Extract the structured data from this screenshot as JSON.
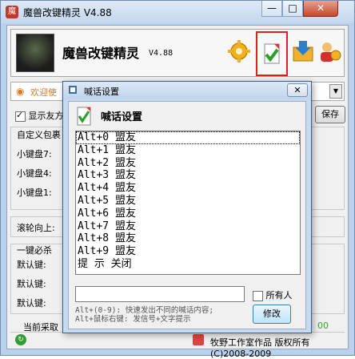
{
  "window": {
    "title": "魔兽改键精灵 V4.88",
    "min": "—",
    "max": "□",
    "close": "✕"
  },
  "header": {
    "app_title": "魔兽改键精灵",
    "version": "V4.88",
    "tools": [
      "gear-icon",
      "checkmark-document-icon",
      "download-folder-icon",
      "user-settings-icon"
    ]
  },
  "welcome": {
    "text": "欢迎使"
  },
  "show_friends": {
    "label": "显示友方",
    "checked": true
  },
  "save_button": "保存",
  "custom_group": {
    "title": "自定义包裹"
  },
  "keypads": [
    "小键盘7:",
    "小键盘4:",
    "小键盘1:"
  ],
  "scroll": {
    "label": "滚轮向上:"
  },
  "one_key_group": {
    "title": "一键必杀"
  },
  "default_keys": [
    "默认键:",
    "默认键:",
    "默认键:"
  ],
  "current_collect": "当前采取",
  "bottom_right": "00",
  "status": {
    "text": "牧野工作室作品 版权所有 (C)2008-2009"
  },
  "dialog": {
    "title": "喊话设置",
    "heading": "喊话设置",
    "close": "✕",
    "list_items": [
      "Alt+0 盟友",
      "Alt+1 盟友",
      "Alt+2 盟友",
      "Alt+3 盟友",
      "Alt+4 盟友",
      "Alt+5 盟友",
      "Alt+6 盟友",
      "Alt+7 盟友",
      "Alt+8 盟友",
      "Alt+9 盟友",
      "提 示 关闭"
    ],
    "input_value": "",
    "all_people_label": "所有人",
    "hint_line1": "Alt+(0-9): 快速发出不同的喊话内容;",
    "hint_line2": "Alt+鼠标右键: 发信号+文字提示",
    "modify_button": "修改"
  },
  "colors": {
    "accent_orange": "#e07820",
    "selection_red": "#e02020",
    "status_green": "#2e9e2e"
  }
}
